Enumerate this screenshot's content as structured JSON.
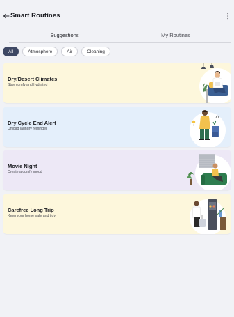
{
  "header": {
    "title": "Smart Routines",
    "back_icon": "arrow-left-icon",
    "more_icon": "more-vertical-icon"
  },
  "tabs": [
    {
      "label": "Suggestions",
      "active": true
    },
    {
      "label": "My Routines",
      "active": false
    }
  ],
  "filters": [
    {
      "label": "All",
      "active": true
    },
    {
      "label": "Atmosphere",
      "active": false
    },
    {
      "label": "Air",
      "active": false
    },
    {
      "label": "Cleaning",
      "active": false
    }
  ],
  "routines": [
    {
      "title": "Dry/Desert Climates",
      "subtitle": "Stay comfy and hydrated",
      "bg": "#fdf7dc",
      "art": "reading-person-illustration"
    },
    {
      "title": "Dry Cycle End Alert",
      "subtitle": "Unload laundry reminder",
      "bg": "#e4effb",
      "art": "laundry-person-illustration"
    },
    {
      "title": "Movie Night",
      "subtitle": "Create a comfy mood",
      "bg": "#ede8f6",
      "art": "sofa-person-illustration"
    },
    {
      "title": "Carefree Long Trip",
      "subtitle": "Keep your home safe and tidy",
      "bg": "#fdf7dc",
      "art": "traveler-illustration"
    }
  ],
  "colors": {
    "background": "#f1f2f6",
    "chip_active": "#3e4864",
    "text": "#1c1d22"
  }
}
